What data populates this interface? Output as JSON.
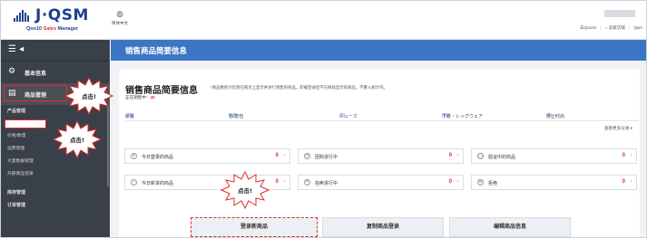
{
  "header": {
    "logo_text": "J·QSM",
    "logo_sub_prefix": "Qoo10 ",
    "logo_sub_sales": "Sales",
    "logo_sub_suffix": " Manager",
    "globe_icon": "globe-icon",
    "lang_label": "简体中文",
    "links": [
      "去Qoo10",
      "|",
      "⌂ 卖家店铺",
      "|",
      "Q&A"
    ]
  },
  "sidebar": {
    "toggle_icon": "☰ ◂",
    "items": [
      {
        "icon": "⚙",
        "label": "基本信息"
      },
      {
        "icon": "▤",
        "label": "商品管理"
      }
    ],
    "section_product": "产品管理",
    "sub_items": [
      "商品登录&修改",
      "价格/数量",
      "运费管理",
      "大量数据管理",
      "外部商品登录"
    ],
    "section_stock": "库存管理",
    "last_item": "订单管理"
  },
  "page": {
    "head_title": "销售商品简要信息",
    "title": "销售商品简要信息",
    "note": "*商品数统计仅限在网页上显示并进行销售的商品。卸载登录但不在网站显示的商品，不算入统计内。",
    "count_label": "正在销售中：",
    "count_value": "40",
    "categories": [
      {
        "name": "女装 ",
        "num": "(20)"
      },
      {
        "name": "包/皮包 ",
        "num": "(12)"
      },
      {
        "name": "シューズ ",
        "num": "(2)"
      },
      {
        "name": "下着・レッグウェア ",
        "num": "(5)"
      },
      {
        "name": "男士时尚 ",
        "num": "(1)"
      }
    ],
    "more_categories": "查看更多分类 ▾",
    "stats": [
      {
        "icon": "+",
        "label": "今日登录的商品",
        "value": "0"
      },
      {
        "icon": "◷",
        "label": "团购进行中",
        "value": "0"
      },
      {
        "icon": "▢",
        "label": "验证中的商品",
        "value": "0"
      },
      {
        "icon": "−",
        "label": "今日新货的商品",
        "value": "0"
      },
      {
        "icon": "✎",
        "label": "拍卖进行中",
        "value": "0"
      },
      {
        "icon": "⊘",
        "label": "拒绝",
        "value": "0"
      }
    ],
    "buttons": [
      "登录新商品",
      "复制商品登录",
      "编辑商品信息"
    ]
  },
  "callouts": [
    "点击!",
    "点击!",
    "点击!"
  ],
  "colors": {
    "accent": "#3b76c4",
    "sidebar": "#3a4049",
    "highlight": "#e22b2b"
  }
}
